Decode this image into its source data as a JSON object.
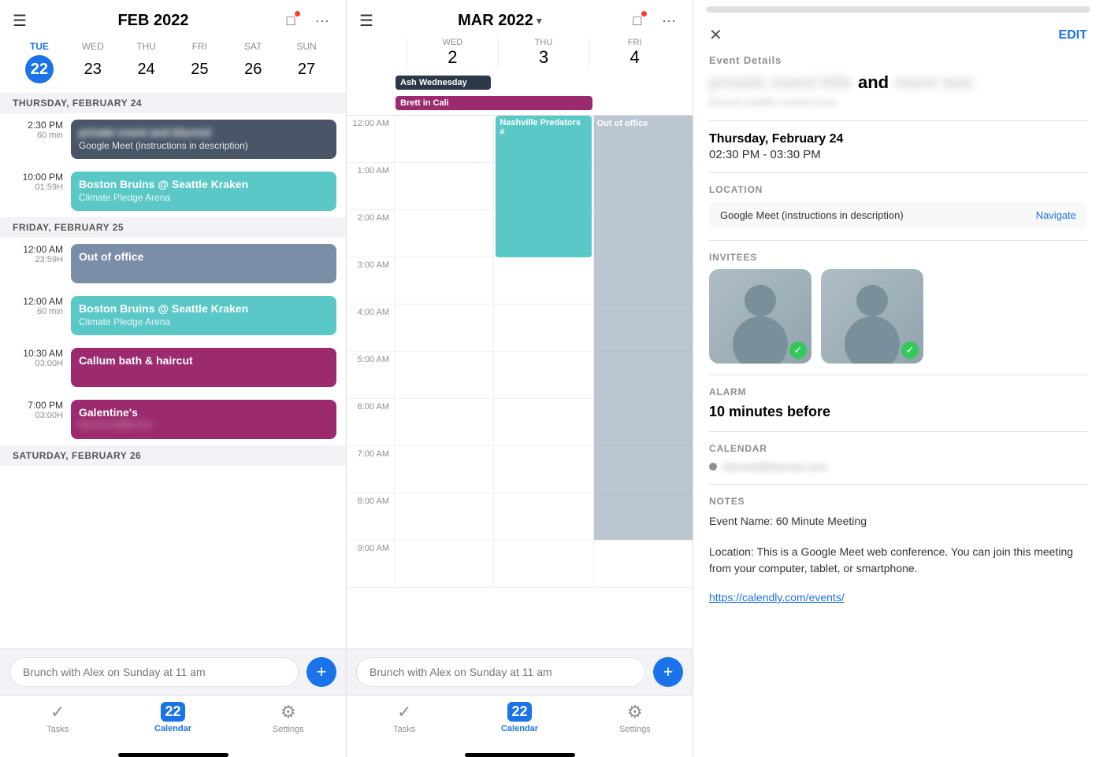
{
  "left": {
    "month_title": "FEB 2022",
    "hamburger": "☰",
    "icons": [
      "□",
      "···"
    ],
    "days": [
      {
        "name": "TUE",
        "num": "22",
        "today": true
      },
      {
        "name": "WED",
        "num": "23",
        "today": false
      },
      {
        "name": "THU",
        "num": "24",
        "today": false
      },
      {
        "name": "FRI",
        "num": "25",
        "today": false
      },
      {
        "name": "SAT",
        "num": "26",
        "today": false
      },
      {
        "name": "SUN",
        "num": "27",
        "today": false
      }
    ],
    "sections": [
      {
        "label": "THURSDAY, FEBRUARY 24",
        "events": [
          {
            "time": "2:30 PM",
            "duration": "60 min",
            "title": "and",
            "subtitle": "Google Meet (instructions in description)",
            "color": "card-blue-dark"
          },
          {
            "time": "10:00 PM",
            "duration": "01:59H",
            "title": "Boston Bruins @ Seattle Kraken",
            "subtitle": "Climate Pledge Arena",
            "color": "card-cyan"
          }
        ]
      },
      {
        "label": "FRIDAY, FEBRUARY 25",
        "events": [
          {
            "time": "12:00 AM",
            "duration": "23:59H",
            "title": "Out of office",
            "subtitle": "",
            "color": "card-blue-gray"
          },
          {
            "time": "12:00 AM",
            "duration": "60 min",
            "title": "Boston Bruins @ Seattle Kraken",
            "subtitle": "Climate Pledge Arena",
            "color": "card-cyan"
          },
          {
            "time": "10:30 AM",
            "duration": "03:00H",
            "title": "Callum bath & haircut",
            "subtitle": "",
            "color": "card-purple"
          },
          {
            "time": "7:00 PM",
            "duration": "03:00H",
            "title": "Galentine's",
            "subtitle": "",
            "color": "card-purple"
          }
        ]
      },
      {
        "label": "SATURDAY, FEBRUARY 26",
        "events": []
      }
    ],
    "search_placeholder": "Brunch with Alex on Sunday at 11 am",
    "nav": [
      {
        "icon": "✓",
        "label": "Tasks",
        "active": false
      },
      {
        "icon": "22",
        "label": "Calendar",
        "active": true
      },
      {
        "icon": "⚙",
        "label": "Settings",
        "active": false
      }
    ]
  },
  "middle": {
    "month_title": "MAR 2022",
    "days": [
      {
        "name": "WED",
        "num": "2"
      },
      {
        "name": "THU",
        "num": "3"
      },
      {
        "name": "FRI",
        "num": "4"
      }
    ],
    "allday_events": [
      {
        "title": "Ash Wednesday",
        "color": "allday-dark",
        "col": 0
      },
      {
        "title": "Brett in Cali",
        "color": "allday-purple",
        "span": 2,
        "col": 0
      }
    ],
    "times": [
      "12:00 AM",
      "1:00 AM",
      "2:00 AM",
      "3:00 AM",
      "4:00 AM",
      "5:00 AM",
      "6:00 AM",
      "7:00 AM",
      "8:00 AM",
      "9:00 AM"
    ],
    "search_placeholder": "Brunch with Alex on Sunday at 11 am",
    "nav": [
      {
        "icon": "✓",
        "label": "Tasks",
        "active": false
      },
      {
        "icon": "22",
        "label": "Calendar",
        "active": true
      },
      {
        "icon": "⚙",
        "label": "Settings",
        "active": false
      }
    ]
  },
  "right": {
    "close_icon": "✕",
    "edit_label": "EDIT",
    "section_event_details": "Event Details",
    "title_blurred_left": "blurred text",
    "and_label": "and",
    "title_blurred_right": "blurred",
    "subtitle_blurred": "blurred subtitle text",
    "section_date": "",
    "date_label": "Thursday, February 24",
    "time_label": "02:30 PM - 03:30 PM",
    "section_location": "LOCATION",
    "location_text": "Google Meet (instructions in description)",
    "navigate_label": "Navigate",
    "section_invitees": "INVITEES",
    "section_alarm": "ALARM",
    "alarm_value": "10 minutes before",
    "section_calendar": "CALENDAR",
    "cal_email": "blurred@blurred.com",
    "section_notes": "NOTES",
    "notes_line1": "Event Name: 60 Minute Meeting",
    "notes_line2": "Location: This is a Google Meet web conference. You can join this meeting from your computer, tablet, or smartphone.",
    "notes_link": "https://calendly.com/events/"
  }
}
